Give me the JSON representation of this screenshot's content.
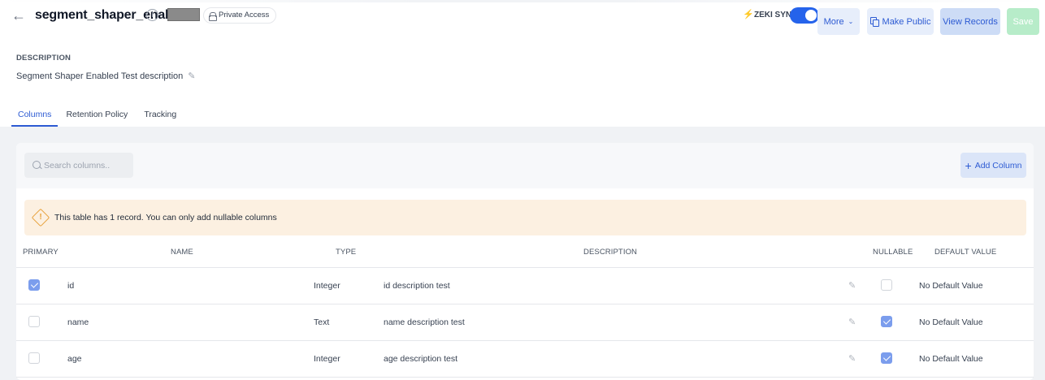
{
  "header": {
    "title": "segment_shaper_enabled",
    "private_badge": "Private Access",
    "zeki_label": "ZEKI SYNC",
    "buttons": {
      "more": "More",
      "make_public": "Make Public",
      "view_records": "View Records",
      "save": "Save"
    }
  },
  "description": {
    "label": "DESCRIPTION",
    "text": "Segment Shaper Enabled Test description"
  },
  "tabs": [
    {
      "label": "Columns",
      "active": true
    },
    {
      "label": "Retention Policy",
      "active": false
    },
    {
      "label": "Tracking",
      "active": false
    }
  ],
  "toolbar": {
    "search_placeholder": "Search columns..",
    "add_column": "Add Column"
  },
  "alert": {
    "text_prefix": "This table has 1 record. ",
    "text_emphasis": "You can only add nullable columns"
  },
  "table": {
    "headers": [
      "PRIMARY",
      "NAME",
      "TYPE",
      "DESCRIPTION",
      "NULLABLE",
      "DEFAULT VALUE"
    ],
    "rows": [
      {
        "primary": true,
        "name": "id",
        "type": "Integer",
        "description": "id description test",
        "nullable": false,
        "default": "No Default Value"
      },
      {
        "primary": false,
        "name": "name",
        "type": "Text",
        "description": "name description test",
        "nullable": true,
        "default": "No Default Value"
      },
      {
        "primary": false,
        "name": "age",
        "type": "Integer",
        "description": "age description test",
        "nullable": true,
        "default": "No Default Value"
      }
    ]
  },
  "colors": {
    "accent": "#2d5bd3",
    "toggle_on": "#2563eb",
    "checkbox_checked": "#7b9ded",
    "alert_bg": "#fcf0e1",
    "save_bg": "#b7ecc9"
  },
  "icons": [
    "back-arrow-icon",
    "info-icon",
    "lock-icon",
    "zeki-icon",
    "chevron-down-icon",
    "copy-icon",
    "pencil-icon",
    "search-icon",
    "plus-icon",
    "warning-icon"
  ]
}
